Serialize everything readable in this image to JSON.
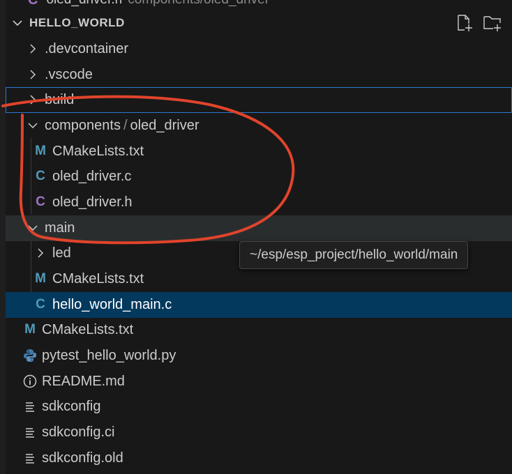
{
  "peek": {
    "icon": "C",
    "name": "oled_driver.h",
    "desc": "components/oled_driver"
  },
  "explorer": {
    "section_title": "HELLO_WORLD",
    "actions": [
      "new-file-icon",
      "new-folder-icon"
    ]
  },
  "tree": [
    {
      "label": ".devcontainer",
      "icon": "chevron-right-icon"
    },
    {
      "label": ".vscode",
      "icon": "chevron-right-icon"
    },
    {
      "label": "build",
      "icon": "chevron-right-icon"
    },
    {
      "label": "components",
      "label_suffix": "oled_driver",
      "separator": "/",
      "icon": "chevron-down-icon"
    },
    {
      "label": "CMakeLists.txt",
      "icon": "M",
      "icon_color": "#519aba"
    },
    {
      "label": "oled_driver.c",
      "icon": "C",
      "icon_color": "#519aba"
    },
    {
      "label": "oled_driver.h",
      "icon": "C",
      "icon_color": "#a074c4"
    },
    {
      "label": "main",
      "icon": "chevron-down-icon"
    },
    {
      "label": "led",
      "icon": "chevron-right-icon"
    },
    {
      "label": "CMakeLists.txt",
      "icon": "M",
      "icon_color": "#519aba"
    },
    {
      "label": "hello_world_main.c",
      "icon": "C",
      "icon_color": "#519aba"
    },
    {
      "label": "CMakeLists.txt",
      "icon": "M",
      "icon_color": "#519aba"
    },
    {
      "label": "pytest_hello_world.py",
      "icon": "python-icon",
      "icon_color": "#3c78aa"
    },
    {
      "label": "README.md",
      "icon": "info-icon",
      "icon_color": "#cccccc"
    },
    {
      "label": "sdkconfig",
      "icon": "lines-icon",
      "icon_color": "#cccccc"
    },
    {
      "label": "sdkconfig.ci",
      "icon": "lines-icon",
      "icon_color": "#cccccc"
    },
    {
      "label": "sdkconfig.old",
      "icon": "lines-icon",
      "icon_color": "#cccccc"
    }
  ],
  "tooltip": {
    "text": "~/esp/esp_project/hello_world/main"
  },
  "colors": {
    "background": "#181818",
    "selected": "#04395e",
    "focus_border": "#2b79d0",
    "annotation": "#e0442c"
  }
}
